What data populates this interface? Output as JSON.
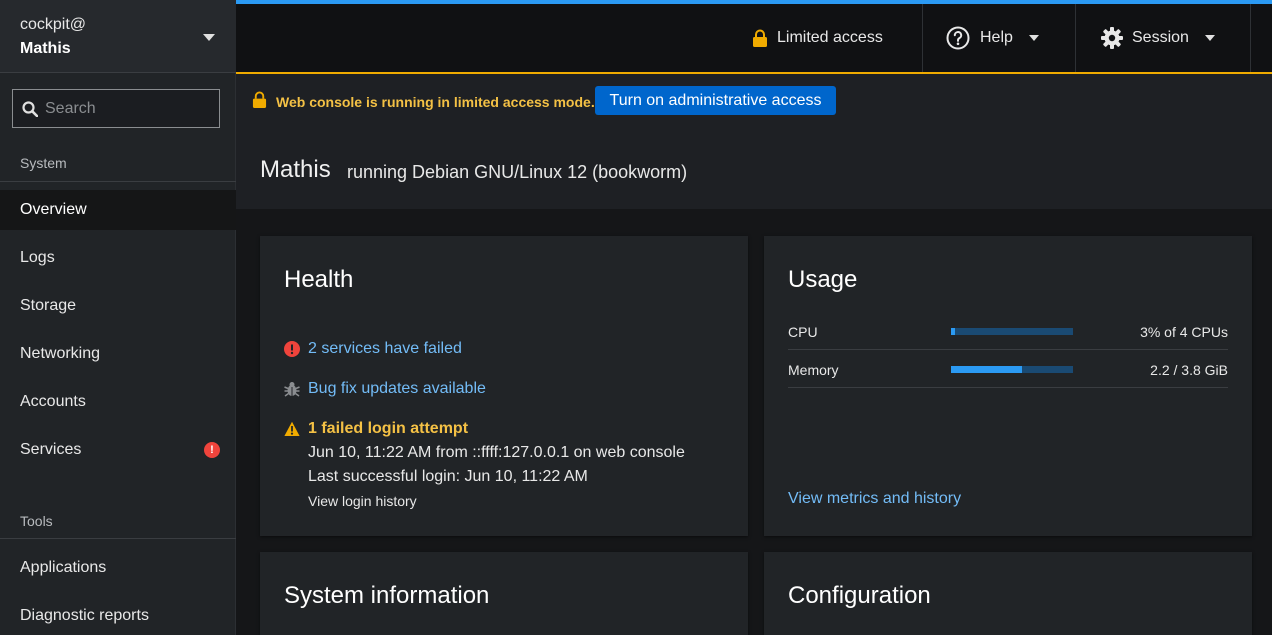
{
  "sidebar": {
    "host_user": "cockpit@",
    "host_name": "Mathis",
    "search_placeholder": "Search",
    "sections": {
      "system": "System",
      "tools": "Tools"
    },
    "items": [
      {
        "label": "Overview",
        "active": true
      },
      {
        "label": "Logs"
      },
      {
        "label": "Storage"
      },
      {
        "label": "Networking"
      },
      {
        "label": "Accounts"
      },
      {
        "label": "Services",
        "badge": "!"
      }
    ],
    "tool_items": [
      {
        "label": "Applications"
      },
      {
        "label": "Diagnostic reports"
      }
    ]
  },
  "topbar": {
    "limited_access": "Limited access",
    "help": "Help",
    "session": "Session"
  },
  "alert": {
    "text": "Web console is running in limited access mode.",
    "button": "Turn on administrative access"
  },
  "page": {
    "host": "Mathis",
    "os": "running Debian GNU/Linux 12 (bookworm)"
  },
  "health": {
    "title": "Health",
    "failed_services": "2 services have failed",
    "updates": "Bug fix updates available",
    "failed_login": "1 failed login attempt",
    "failed_login_detail": "Jun 10, 11:22 AM from ::ffff:127.0.0.1 on web console",
    "last_login": "Last successful login: Jun 10, 11:22 AM",
    "view_history": "View login history"
  },
  "usage": {
    "title": "Usage",
    "cpu_label": "CPU",
    "cpu_value": "3% of 4 CPUs",
    "cpu_fraction": 0.03,
    "memory_label": "Memory",
    "memory_value": "2.2 / 3.8 GiB",
    "memory_fraction": 0.58,
    "view_metrics": "View metrics and history"
  },
  "cards": {
    "system_info": "System information",
    "configuration": "Configuration"
  },
  "colors": {
    "accent_blue": "#2b9af3",
    "warning": "#f0ab00",
    "danger": "#f0443c",
    "link": "#73bcf7"
  }
}
